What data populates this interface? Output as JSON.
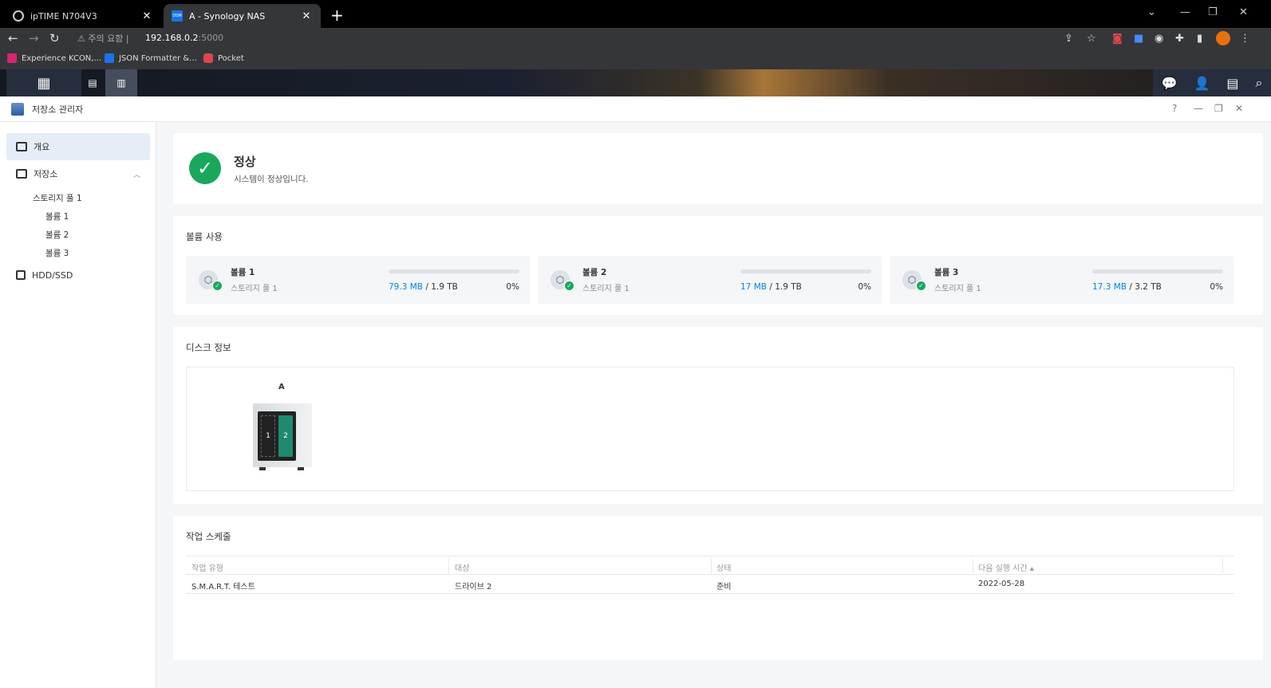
{
  "browser": {
    "tabs": [
      {
        "title": "ipTIME N704V3",
        "active": false
      },
      {
        "title": "A - Synology NAS",
        "active": true
      }
    ],
    "address": {
      "warning": "주의 요함",
      "host": "192.168.0.2",
      "port": ":5000"
    },
    "bookmarks": [
      {
        "label": "Experience KCON,..."
      },
      {
        "label": "JSON Formatter &..."
      },
      {
        "label": "Pocket"
      }
    ]
  },
  "window": {
    "title": "저장소 관리자"
  },
  "sidebar": {
    "overview": "개요",
    "storage": "저장소",
    "pool": "스토리지 풀 1",
    "volumes": [
      "볼륨 1",
      "볼륨 2",
      "볼륨 3"
    ],
    "hdd": "HDD/SSD"
  },
  "status": {
    "title": "정상",
    "subtitle": "시스템이 정상입니다."
  },
  "volume_usage": {
    "title": "볼륨 사용",
    "volumes": [
      {
        "name": "볼륨 1",
        "pool": "스토리지 풀 1",
        "used": "79.3 MB",
        "total": "/ 1.9 TB",
        "percent": "0%"
      },
      {
        "name": "볼륨 2",
        "pool": "스토리지 풀 1",
        "used": "17 MB",
        "total": "/ 1.9 TB",
        "percent": "0%"
      },
      {
        "name": "볼륨 3",
        "pool": "스토리지 풀 1",
        "used": "17.3 MB",
        "total": "/ 3.2 TB",
        "percent": "0%"
      }
    ]
  },
  "disk_info": {
    "title": "디스크 정보",
    "nas_name": "A",
    "bays": [
      "1",
      "2"
    ]
  },
  "schedule": {
    "title": "작업 스케줄",
    "columns": [
      "작업 유형",
      "대상",
      "상태",
      "다음 실행 시간 ▴"
    ],
    "rows": [
      [
        "S.M.A.R.T. 테스트",
        "드라이브 2",
        "준비",
        "2022-05-28"
      ]
    ]
  }
}
